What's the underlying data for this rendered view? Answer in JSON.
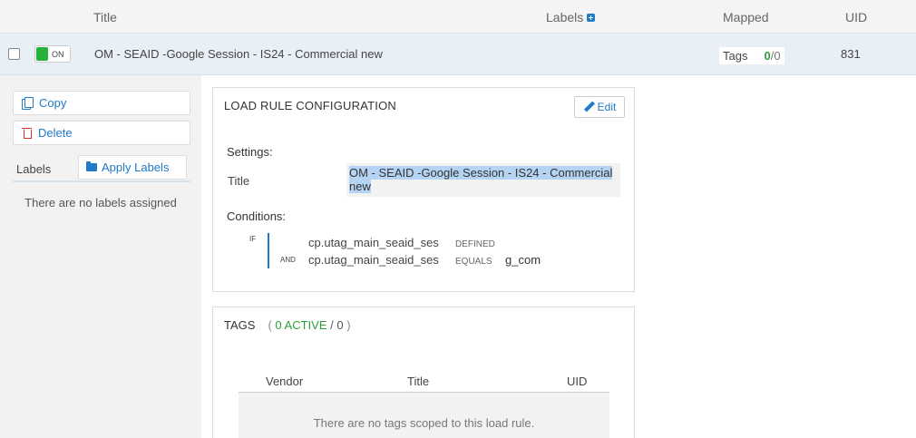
{
  "table_header": {
    "title": "Title",
    "labels": "Labels",
    "mapped": "Mapped",
    "uid": "UID",
    "labels_add_icon": "plus-square-icon"
  },
  "row": {
    "toggle_label": "ON",
    "toggle_state": "on",
    "toggle_color": "#27b33a",
    "title": "OM - SEAID -Google Session - IS24 - Commercial new",
    "tags_label": "Tags",
    "tags_active": "0",
    "tags_total": "/0",
    "uid": "831"
  },
  "actions": {
    "copy": "Copy",
    "delete": "Delete",
    "labels_heading": "Labels",
    "apply_labels": "Apply Labels",
    "no_labels": "There are no labels assigned"
  },
  "config": {
    "heading": "LOAD RULE CONFIGURATION",
    "edit": "Edit",
    "settings_label": "Settings:",
    "title_key": "Title",
    "title_value": "OM - SEAID -Google Session - IS24 - Commercial new",
    "conditions_label": "Conditions:",
    "if_tag": "IF",
    "and_tag": "AND",
    "conditions": [
      {
        "variable": "cp.utag_main_seaid_ses",
        "operator": "DEFINED",
        "value": ""
      },
      {
        "variable": "cp.utag_main_seaid_ses",
        "operator": "EQUALS",
        "value": "g_com"
      }
    ]
  },
  "tags": {
    "heading": "TAGS",
    "open_paren": "(",
    "active_text": "0 ACTIVE",
    "total_text": "/ 0",
    "close_paren": ")",
    "columns": {
      "vendor": "Vendor",
      "title": "Title",
      "uid": "UID"
    },
    "empty": "There are no tags scoped to this load rule."
  },
  "colors": {
    "accent": "#1f7ac9",
    "success": "#2e9e3b",
    "danger": "#d9302c",
    "selection": "#b5d4f3",
    "row_selected": "#e8eff7"
  }
}
